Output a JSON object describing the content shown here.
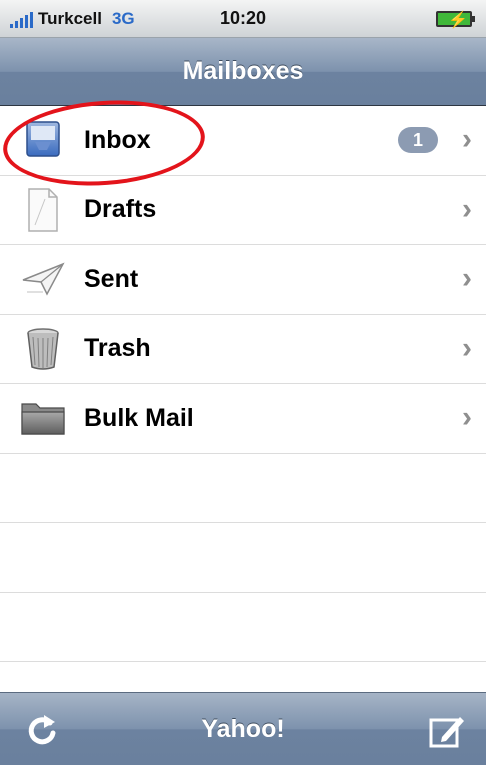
{
  "status_bar": {
    "carrier": "Turkcell",
    "network": "3G",
    "time": "10:20",
    "battery_icon": "battery-charging-icon",
    "signal_icon": "signal-bars-icon"
  },
  "nav": {
    "title": "Mailboxes"
  },
  "mailboxes": [
    {
      "label": "Inbox",
      "icon": "inbox-icon",
      "badge": "1"
    },
    {
      "label": "Drafts",
      "icon": "drafts-icon"
    },
    {
      "label": "Sent",
      "icon": "sent-icon"
    },
    {
      "label": "Trash",
      "icon": "trash-icon"
    },
    {
      "label": "Bulk Mail",
      "icon": "folder-icon"
    }
  ],
  "toolbar": {
    "title": "Yahoo!",
    "refresh_icon": "refresh-icon",
    "compose_icon": "compose-icon"
  },
  "colors": {
    "nav_blue": "#7d92ad",
    "badge": "#8c9bb2",
    "annotation_red": "#e3141b"
  }
}
